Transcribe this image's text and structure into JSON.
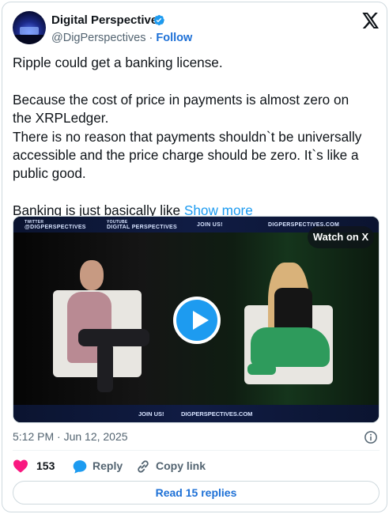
{
  "author": {
    "name": "Digital Perspectives",
    "handle": "@DigPerspectives",
    "separator": "·",
    "follow_label": "Follow"
  },
  "tweet": {
    "lines": [
      "Ripple could get a banking license.",
      "",
      "Because the cost of price in payments is almost zero on",
      "the XRPLedger.",
      "There is no reason that payments shouldn`t be universally",
      "accessible and the price charge should be zero. It`s like a",
      "public good.",
      "",
      "Banking is just basically like"
    ],
    "show_more": "Show more"
  },
  "media": {
    "watch_label": "Watch on X",
    "banner_top": {
      "twitter_small": "TWITTER",
      "twitter_handle": "@DIGPERSPECTIVES",
      "youtube_small": "YOUTUBE",
      "youtube_name": "DIGITAL PERSPECTIVES",
      "join": "JOIN US!",
      "site": "DIGPERSPECTIVES.COM"
    },
    "banner_bottom": {
      "join": "JOIN US!",
      "site": "DIGPERSPECTIVES.COM"
    }
  },
  "timestamp": "5:12 PM · Jun 12, 2025",
  "actions": {
    "likes_count": "153",
    "reply_label": "Reply",
    "copy_link_label": "Copy link"
  },
  "read_replies_label": "Read 15 replies",
  "colors": {
    "accent": "#1d9bf0",
    "link": "#1d70d6",
    "like": "#f91880",
    "muted": "#536471"
  },
  "icons": [
    "verified-badge-icon",
    "x-logo-icon",
    "play-icon",
    "info-icon",
    "heart-icon",
    "reply-bubble-icon",
    "link-icon"
  ]
}
